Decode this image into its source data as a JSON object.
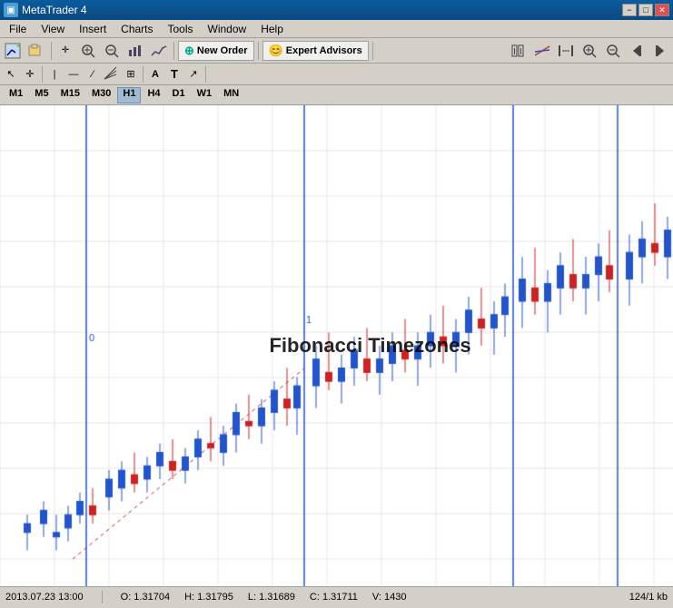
{
  "titleBar": {
    "title": "MetaTrader 4",
    "minimizeLabel": "−",
    "maximizeLabel": "□",
    "closeLabel": "✕"
  },
  "menuBar": {
    "items": [
      "File",
      "View",
      "Insert",
      "Charts",
      "Tools",
      "Window",
      "Help"
    ]
  },
  "toolbar1": {
    "newOrderLabel": "New Order",
    "expertAdvisorsLabel": "Expert Advisors"
  },
  "toolbar2": {
    "tools": [
      "↖",
      "+",
      "|",
      "∕",
      "⁺",
      "⋮⁻",
      "A",
      "T",
      "↗"
    ]
  },
  "timeframes": {
    "items": [
      "M1",
      "M5",
      "M15",
      "M30",
      "H1",
      "H4",
      "D1",
      "W1",
      "MN"
    ],
    "active": "H1"
  },
  "chart": {
    "title": "Fibonacci Timezones",
    "annotation0": "0",
    "annotation1": "1"
  },
  "statusBar": {
    "datetime": "2013.07.23 13:00",
    "open": "O: 1.31704",
    "high": "H: 1.31795",
    "low": "L: 1.31689",
    "close": "C: 1.31711",
    "volume": "V: 1430",
    "info": "124/1 kb"
  }
}
